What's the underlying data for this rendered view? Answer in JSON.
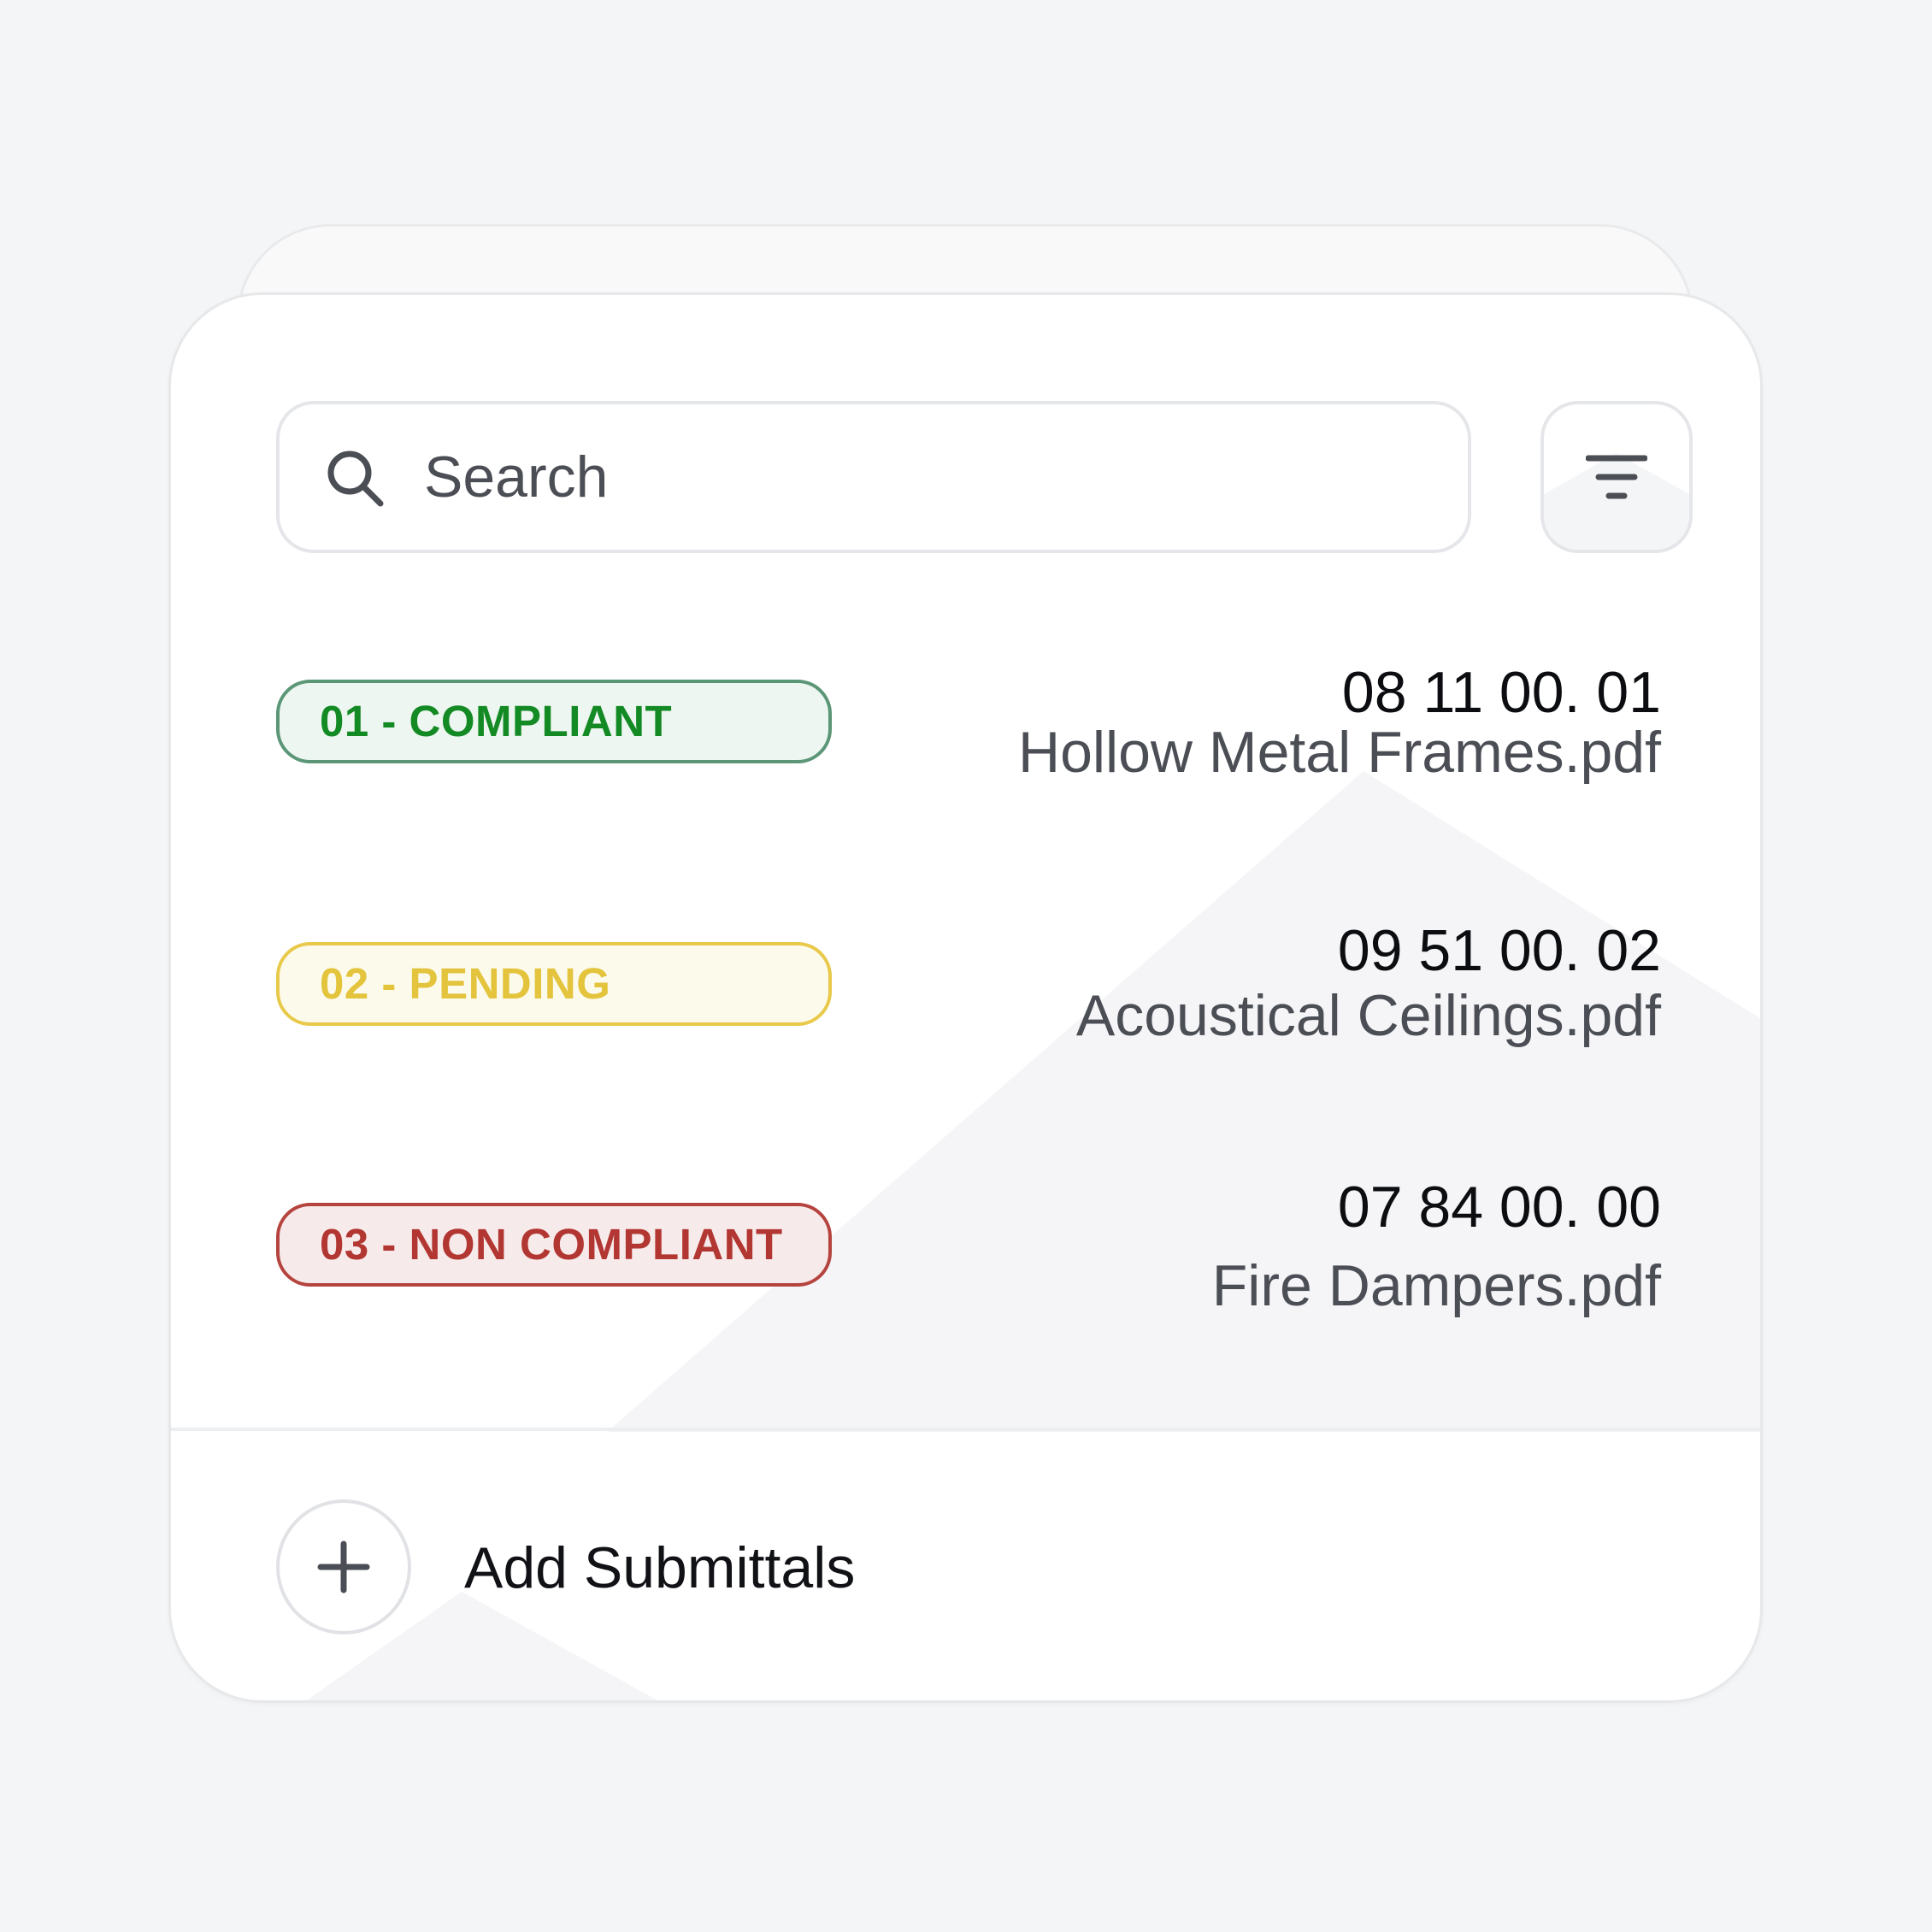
{
  "search": {
    "placeholder": "Search",
    "icon": "search-icon"
  },
  "filter": {
    "icon": "filter-icon"
  },
  "submittals": [
    {
      "status": "01 - COMPLIANT",
      "status_type": "compliant",
      "status_color": "#138a24",
      "code": "08 11 00. 01",
      "filename": "Hollow Metal Frames.pdf"
    },
    {
      "status": "02 - PENDING",
      "status_type": "pending",
      "status_color": "#e3c43c",
      "code": "09 51 00. 02",
      "filename": "Acoustical Ceilings.pdf"
    },
    {
      "status": "03 - NON COMPLIANT",
      "status_type": "non-compliant",
      "status_color": "#b23631",
      "code": "07 84 00. 00",
      "filename": "Fire Dampers.pdf"
    }
  ],
  "footer": {
    "add_label": "Add Submittals",
    "add_icon": "plus-icon"
  }
}
